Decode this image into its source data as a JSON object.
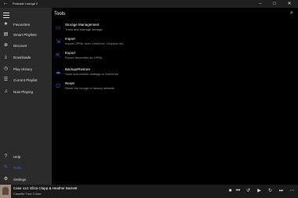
{
  "window": {
    "title": "Podcast Lounge 2",
    "back_glyph": "←",
    "minimize_glyph": "–",
    "maximize_glyph": "□",
    "close_glyph": "✕"
  },
  "sidebar": {
    "items": [
      {
        "label": "Favourites",
        "icon": "star-icon",
        "glyph": "★"
      },
      {
        "label": "Smart Playlists",
        "icon": "playlist-icon",
        "glyph": "▤"
      },
      {
        "label": "Discover",
        "icon": "globe-icon",
        "glyph": "⊕"
      },
      {
        "label": "Downloads",
        "icon": "download-icon",
        "glyph": "⤓"
      },
      {
        "label": "Play History",
        "icon": "history-icon",
        "glyph": "◷"
      },
      {
        "label": "Current Playlist",
        "icon": "list-icon",
        "glyph": "☰"
      },
      {
        "label": "Now Playing",
        "icon": "music-note-icon",
        "glyph": "♫"
      }
    ],
    "bottom_items": [
      {
        "label": "Help",
        "icon": "help-icon",
        "glyph": "?"
      },
      {
        "label": "Tools",
        "icon": "wrench-icon",
        "glyph": "✎"
      },
      {
        "label": "Settings",
        "icon": "gear-icon",
        "glyph": "⚙"
      }
    ]
  },
  "main": {
    "title": "Tools",
    "search_glyph": "⌕",
    "tools": [
      {
        "name": "Storage Management",
        "desc": "Track and manage storage",
        "icon": "storage-icon",
        "glyph": "▭"
      },
      {
        "name": "Import",
        "desc": "Import OPML from OneDrive, Dropbox etc.",
        "icon": "import-icon",
        "glyph": "⇲"
      },
      {
        "name": "Export",
        "desc": "Export favourites as OPML",
        "icon": "export-icon",
        "glyph": "⇱"
      },
      {
        "name": "Backup/Restore",
        "desc": "Save and restore settings to OneDrive",
        "icon": "backup-icon",
        "glyph": "☁"
      },
      {
        "name": "Reset",
        "desc": "Reset the lounge to factory defaults",
        "icon": "reset-icon",
        "glyph": "⏻"
      }
    ]
  },
  "player": {
    "track": "Case 114: Eliza Clapp & Heather Barnett",
    "show": "Casefile True Crime",
    "controls": [
      {
        "name": "stop-icon",
        "glyph": "■"
      },
      {
        "name": "skip-back-icon",
        "glyph": "⏮"
      },
      {
        "name": "rewind-icon",
        "glyph": "↺"
      },
      {
        "name": "play-icon",
        "glyph": "▶"
      },
      {
        "name": "forward-icon",
        "glyph": "↻"
      },
      {
        "name": "skip-forward-icon",
        "glyph": "⏭"
      },
      {
        "name": "more-icon",
        "glyph": "⋯"
      }
    ]
  },
  "colors": {
    "accent": "#2d6cdf",
    "sidebar_bg": "#2b2b2b",
    "main_bg": "#000000",
    "player_bg": "#1a1a1a"
  }
}
